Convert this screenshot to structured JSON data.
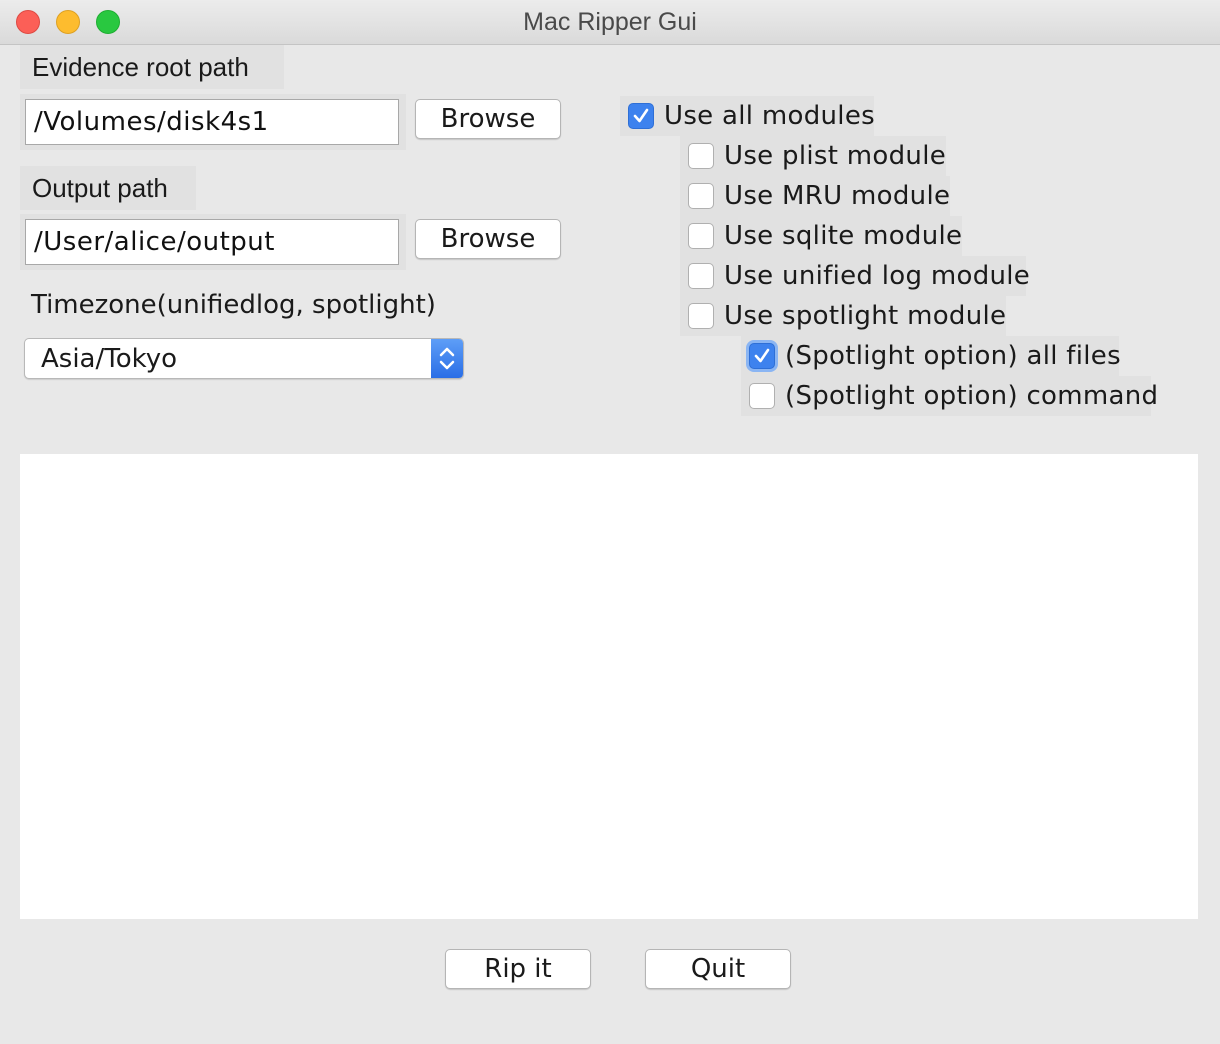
{
  "window": {
    "title": "Mac Ripper Gui"
  },
  "evidence": {
    "label": "Evidence root path",
    "value": "/Volumes/disk4s1",
    "browse_label": "Browse"
  },
  "output": {
    "label": "Output path",
    "value": "/User/alice/output",
    "browse_label": "Browse"
  },
  "timezone": {
    "label": "Timezone(unifiedlog, spotlight)",
    "selected": "Asia/Tokyo"
  },
  "modules": {
    "all": {
      "label": "Use all modules",
      "checked": true
    },
    "plist": {
      "label": "Use plist module",
      "checked": false
    },
    "mru": {
      "label": "Use MRU module",
      "checked": false
    },
    "sqlite": {
      "label": "Use sqlite module",
      "checked": false
    },
    "unifiedlog": {
      "label": "Use unified log module",
      "checked": false
    },
    "spotlight": {
      "label": "Use spotlight module",
      "checked": false
    },
    "spotlight_all_files": {
      "label": "(Spotlight option) all files",
      "checked": true
    },
    "spotlight_command": {
      "label": "(Spotlight option) command",
      "checked": false
    }
  },
  "log_output": {
    "text": ""
  },
  "actions": {
    "rip_label": "Rip it",
    "quit_label": "Quit"
  },
  "colors": {
    "accent": "#3d82ee",
    "window_bg": "#e8e8e8"
  }
}
